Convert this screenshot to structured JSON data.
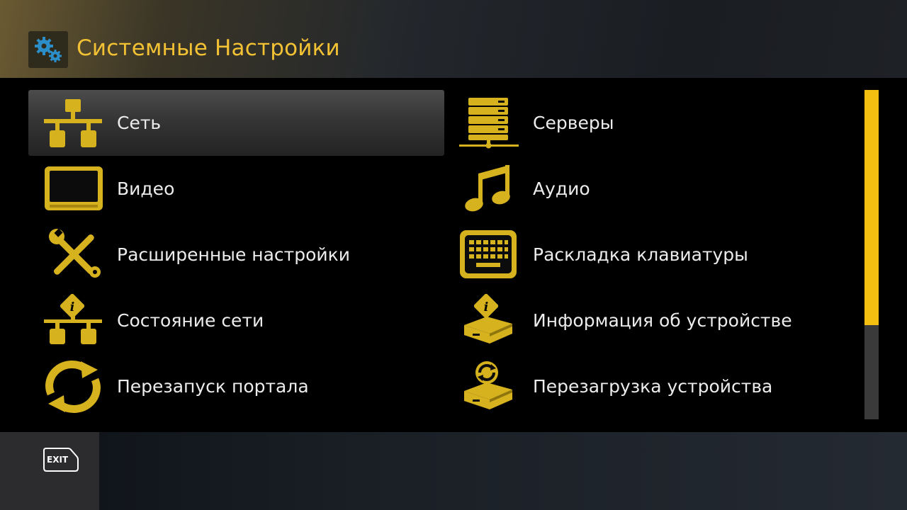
{
  "header": {
    "icon": "gears-icon",
    "title": "Системные Настройки"
  },
  "menu": {
    "left": [
      {
        "label": "Сеть",
        "icon": "network-icon",
        "selected": true
      },
      {
        "label": "Видео",
        "icon": "tv-icon"
      },
      {
        "label": "Расширенные настройки",
        "icon": "tools-icon"
      },
      {
        "label": "Состояние сети",
        "icon": "network-info-icon"
      },
      {
        "label": "Перезапуск портала",
        "icon": "restart-icon"
      }
    ],
    "right": [
      {
        "label": "Серверы",
        "icon": "servers-icon"
      },
      {
        "label": "Аудио",
        "icon": "music-note-icon"
      },
      {
        "label": "Раскладка клавиатуры",
        "icon": "keyboard-icon"
      },
      {
        "label": "Информация об устройстве",
        "icon": "device-info-icon"
      },
      {
        "label": "Перезагрузка устройства",
        "icon": "device-reboot-icon"
      }
    ]
  },
  "scroll": {
    "position_fraction": 0.715
  },
  "footer": {
    "exit_key": "EXIT"
  },
  "colors": {
    "accent": "#f2c234",
    "icon_gold": "#d6b21e",
    "scroll_thumb": "#f4bf10"
  }
}
